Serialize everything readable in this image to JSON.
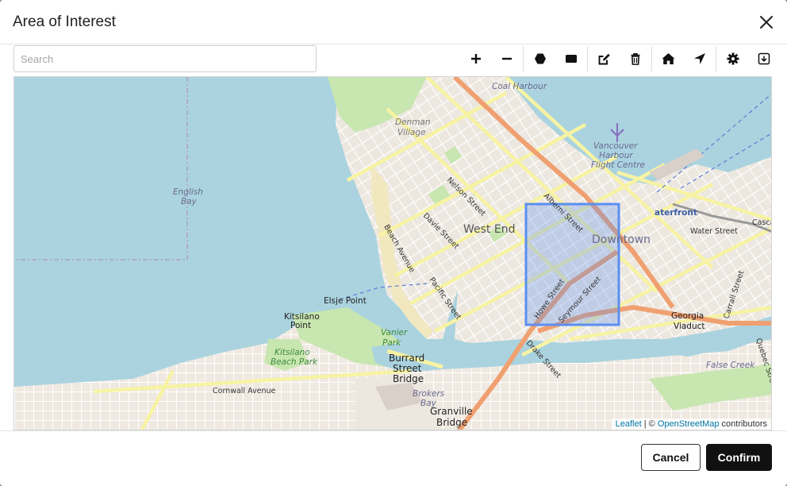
{
  "dialog": {
    "title": "Area of Interest",
    "close_icon": "close-icon"
  },
  "search": {
    "placeholder": "Search",
    "value": ""
  },
  "toolbar": {
    "buttons": [
      {
        "name": "zoom-in",
        "icon": "plus-icon"
      },
      {
        "name": "zoom-out",
        "icon": "minus-icon"
      },
      {
        "name": "draw-polygon",
        "icon": "hexagon-icon"
      },
      {
        "name": "draw-rectangle",
        "icon": "rectangle-icon"
      },
      {
        "name": "edit-shapes",
        "icon": "edit-icon"
      },
      {
        "name": "delete-shapes",
        "icon": "trash-icon"
      },
      {
        "name": "home",
        "icon": "home-icon"
      },
      {
        "name": "locate",
        "icon": "location-arrow-icon"
      },
      {
        "name": "settings",
        "icon": "gear-icon"
      },
      {
        "name": "download",
        "icon": "download-icon"
      }
    ]
  },
  "map": {
    "labels": {
      "coal_harbour": "Coal Harbour",
      "denman_village_1": "Denman",
      "denman_village_2": "Village",
      "vancouver_1": "Vancouver",
      "vancouver_2": "Harbour",
      "vancouver_3": "Flight Centre",
      "english_bay_1": "English",
      "english_bay_2": "Bay",
      "nelson_street": "Nelson Street",
      "alberni_street": "Alberni Street",
      "waterfront": "aterfront",
      "davie_street": "Davie Street",
      "west_end": "West End",
      "downtown": "Downtown",
      "water_street": "Water Street",
      "beach_avenue": "Beach Avenue",
      "pacific_street": "Pacific Street",
      "howe_street": "Howe Street",
      "seymour_street": "Seymour Street",
      "elsje_point": "Elsje Point",
      "kitsilano_point_1": "Kitsilano",
      "kitsilano_point_2": "Point",
      "georgia_1": "Georgia",
      "georgia_2": "Viaduct",
      "vanier_1": "Vanier",
      "vanier_2": "Park",
      "kits_beach_1": "Kitsilano",
      "kits_beach_2": "Beach Park",
      "burrard_1": "Burrard",
      "burrard_2": "Street",
      "burrard_3": "Bridge",
      "drake_street": "Drake Street",
      "cornwall_avenue": "Cornwall Avenue",
      "brokers_bay_1": "Brokers",
      "brokers_bay_2": "Bay",
      "granville_1": "Granville",
      "granville_2": "Bridge",
      "false_creek": "False Creek",
      "quebec_street": "Quebec Street",
      "garrall": "Carrall Street",
      "cascade": "Casca"
    },
    "aoi_color": "#5b8ff0",
    "attribution": {
      "leaflet": "Leaflet",
      "sep": " | © ",
      "osm": "OpenStreetMap",
      "suffix": " contributors"
    }
  },
  "footer": {
    "cancel_label": "Cancel",
    "confirm_label": "Confirm"
  }
}
